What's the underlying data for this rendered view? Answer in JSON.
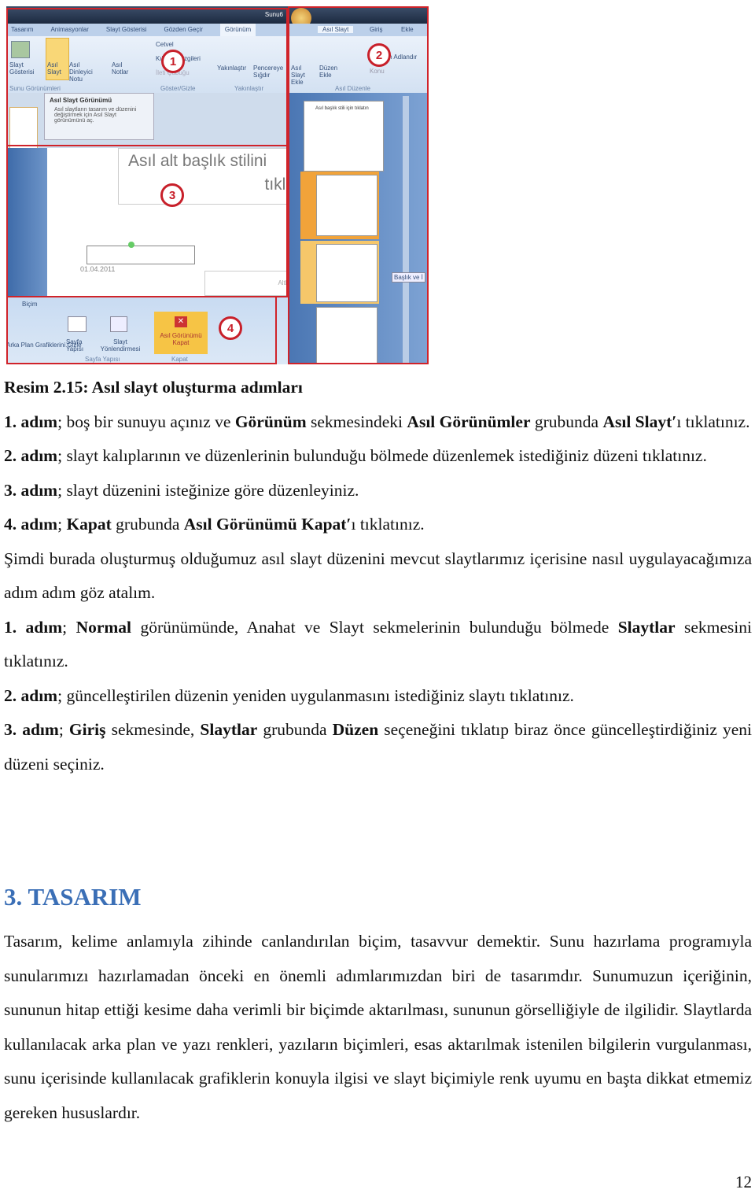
{
  "figure": {
    "left_tabs": [
      "Tasarım",
      "Animasyonlar",
      "Slayt Gösterisi",
      "Gözden Geçir",
      "Görünüm"
    ],
    "title_fragment": "Sunu6",
    "ribbon_buttons": [
      "Slayt Gösterisi",
      "Asıl Slayt",
      "Asıl Dinleyici Notu",
      "Asıl Notlar"
    ],
    "group_label_views": "Sunu Görünümleri",
    "checkboxes": [
      "Cetvel",
      "Kılavuz Çizgileri",
      "İleti Çubuğu"
    ],
    "group_label_show": "Göster/Gizle",
    "zoom_buttons": [
      "Yakınlaştır",
      "Pencereye Sığdır"
    ],
    "group_label_zoom": "Yakınlaştır",
    "tooltip": {
      "title": "Asıl Slayt Görünümü",
      "body": "Asıl slaytların tasarım ve düzenini değiştirmek için Asıl Slayt görünümünü aç."
    },
    "slide_subtitle": "Asıl alt başlık stilini",
    "slide_subtitle_2": "tıkla",
    "date": "01.04.2011",
    "footer_fragment": "Altbi",
    "right_tabs": [
      "Asıl Slayt",
      "Giriş",
      "Ekle"
    ],
    "right_buttons": [
      "Asıl Slayt Ekle",
      "Düzen Ekle",
      "Yeniden Adlandır",
      "Konu"
    ],
    "group_label_edit": "Asıl Düzenle",
    "thumb_title": "Asıl başlık stili için tıklatın",
    "tooltip_layout": "Başlık ve İ",
    "bottom_tab": "Biçim",
    "bottom_left_fragment": "Arka Plan Grafiklerini Gizle",
    "bottom_buttons": [
      "Sayfa Yapısı",
      "Slayt Yönlendirmesi",
      "Asıl Görünümü Kapat"
    ],
    "group_label_page": "Sayfa Yapısı",
    "group_label_close": "Kapat",
    "step_numbers": [
      "1",
      "2",
      "3",
      "4"
    ],
    "colors": {
      "highlight": "#d0232a",
      "ribbon": "#dbe6f4",
      "active": "#f6c445"
    }
  },
  "paragraphs": [
    [
      {
        "t": "Resim 2.15: Asıl slayt oluşturma adımları",
        "b": true
      }
    ],
    [
      {
        "t": "1. adım",
        "b": true
      },
      {
        "t": "; boş bir sunuyu açınız ve "
      },
      {
        "t": "Görünüm",
        "b": true
      },
      {
        "t": " sekmesindeki "
      },
      {
        "t": "Asıl Görünümler",
        "b": true
      },
      {
        "t": " grubunda "
      },
      {
        "t": "Asıl Slayt′",
        "b": true
      },
      {
        "t": "ı tıklatınız."
      }
    ],
    [
      {
        "t": "2. adım",
        "b": true
      },
      {
        "t": "; slayt kalıplarının ve düzenlerinin bulunduğu bölmede düzenlemek istediğiniz düzeni tıklatınız."
      }
    ],
    [
      {
        "t": "3. adım",
        "b": true
      },
      {
        "t": "; slayt düzenini isteğinize göre düzenleyiniz."
      }
    ],
    [
      {
        "t": "4. adım",
        "b": true
      },
      {
        "t": "; "
      },
      {
        "t": "Kapat",
        "b": true
      },
      {
        "t": " grubunda "
      },
      {
        "t": "Asıl Görünümü Kapat′",
        "b": true
      },
      {
        "t": "ı tıklatınız."
      }
    ],
    [
      {
        "t": "Şimdi burada oluşturmuş olduğumuz asıl slayt düzenini mevcut slaytlarımız içerisine nasıl uygulayacağımıza adım adım göz atalım."
      }
    ],
    [
      {
        "t": "1. adım",
        "b": true
      },
      {
        "t": "; "
      },
      {
        "t": "Normal",
        "b": true
      },
      {
        "t": " görünümünde, Anahat ve Slayt sekmelerinin bulunduğu bölmede "
      },
      {
        "t": "Slaytlar",
        "b": true
      },
      {
        "t": " sekmesini tıklatınız."
      }
    ],
    [
      {
        "t": "2. adım",
        "b": true
      },
      {
        "t": "; güncelleştirilen düzenin yeniden uygulanmasını istediğiniz slaytı tıklatınız."
      }
    ],
    [
      {
        "t": "3. adım",
        "b": true
      },
      {
        "t": "; "
      },
      {
        "t": "Giriş",
        "b": true
      },
      {
        "t": " sekmesinde, "
      },
      {
        "t": "Slaytlar",
        "b": true
      },
      {
        "t": " grubunda "
      },
      {
        "t": "Düzen",
        "b": true
      },
      {
        "t": " seçeneğini tıklatıp biraz önce güncelleştirdiğiniz yeni düzeni seçiniz."
      }
    ]
  ],
  "heading": "3. TASARIM",
  "body": [
    [
      {
        "t": "Tasarım, kelime anlamıyla zihinde canlandırılan biçim, tasavvur demektir. Sunu hazırlama programıyla sunularımızı hazırlamadan önceki en önemli adımlarımızdan biri de tasarımdır. Sunumuzun içeriğinin, sununun hitap ettiği kesime daha verimli bir biçimde aktarılması, sununun görselliğiyle de ilgilidir. Slaytlarda kullanılacak arka plan ve yazı renkleri, yazıların biçimleri, esas aktarılmak istenilen bilgilerin vurgulanması, sunu içerisinde kullanılacak grafiklerin konuyla ilgisi ve slayt biçimiyle renk uyumu en başta dikkat etmemiz gereken hususlardır."
      }
    ]
  ],
  "page_number": "12"
}
